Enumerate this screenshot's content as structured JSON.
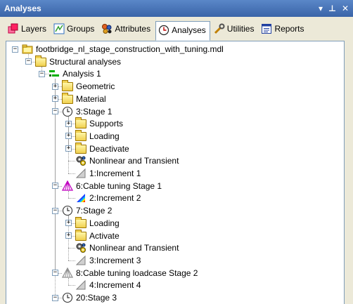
{
  "window": {
    "title": "Analyses",
    "controls": {
      "menu": "▾",
      "pin": "⊥",
      "close": "✕"
    }
  },
  "tabs": [
    {
      "label": "Layers",
      "icon": "layers-icon",
      "active": false
    },
    {
      "label": "Groups",
      "icon": "groups-icon",
      "active": false
    },
    {
      "label": "Attributes",
      "icon": "attributes-icon",
      "active": false
    },
    {
      "label": "Analyses",
      "icon": "analyses-icon",
      "active": true
    },
    {
      "label": "Utilities",
      "icon": "utilities-icon",
      "active": false
    },
    {
      "label": "Reports",
      "icon": "reports-icon",
      "active": false
    }
  ],
  "tree": [
    {
      "label": "footbridge_nl_stage_construction_with_tuning.mdl",
      "icon": "model-folder-icon",
      "expander": "−",
      "level": 0
    },
    {
      "label": "Structural analyses",
      "icon": "folder-open-icon",
      "expander": "−",
      "level": 1
    },
    {
      "label": "Analysis 1",
      "icon": "analysis-icon",
      "expander": "−",
      "level": 2
    },
    {
      "label": "Geometric",
      "icon": "folder-icon",
      "expander": "+",
      "level": 3
    },
    {
      "label": "Material",
      "icon": "folder-icon",
      "expander": "+",
      "level": 3
    },
    {
      "label": "3:Stage 1",
      "icon": "stage-clock-icon",
      "expander": "−",
      "level": 3
    },
    {
      "label": "Supports",
      "icon": "folder-icon",
      "expander": "+",
      "level": 4
    },
    {
      "label": "Loading",
      "icon": "folder-icon",
      "expander": "+",
      "level": 4
    },
    {
      "label": "Deactivate",
      "icon": "folder-icon",
      "expander": "+",
      "level": 4
    },
    {
      "label": "Nonlinear and Transient",
      "icon": "gears-icon",
      "expander": "",
      "level": 4
    },
    {
      "label": "1:Increment 1",
      "icon": "increment-grey-icon",
      "expander": "",
      "level": 4
    },
    {
      "label": "6:Cable tuning Stage 1",
      "icon": "cable-tuning-icon",
      "expander": "−",
      "level": 3
    },
    {
      "label": "2:Increment 2",
      "icon": "increment-color-icon",
      "expander": "",
      "level": 4
    },
    {
      "label": "7:Stage 2",
      "icon": "stage-clock-icon",
      "expander": "−",
      "level": 3
    },
    {
      "label": "Loading",
      "icon": "folder-icon",
      "expander": "+",
      "level": 4
    },
    {
      "label": "Activate",
      "icon": "folder-icon",
      "expander": "+",
      "level": 4
    },
    {
      "label": "Nonlinear and Transient",
      "icon": "gears-icon",
      "expander": "",
      "level": 4
    },
    {
      "label": "3:Increment 3",
      "icon": "increment-grey-icon",
      "expander": "",
      "level": 4
    },
    {
      "label": "8:Cable tuning loadcase Stage 2",
      "icon": "cable-tuning-grey-icon",
      "expander": "−",
      "level": 3
    },
    {
      "label": "4:Increment 4",
      "icon": "increment-grey-icon",
      "expander": "",
      "level": 4
    },
    {
      "label": "20:Stage 3",
      "icon": "stage-clock-icon",
      "expander": "−",
      "level": 3
    }
  ]
}
